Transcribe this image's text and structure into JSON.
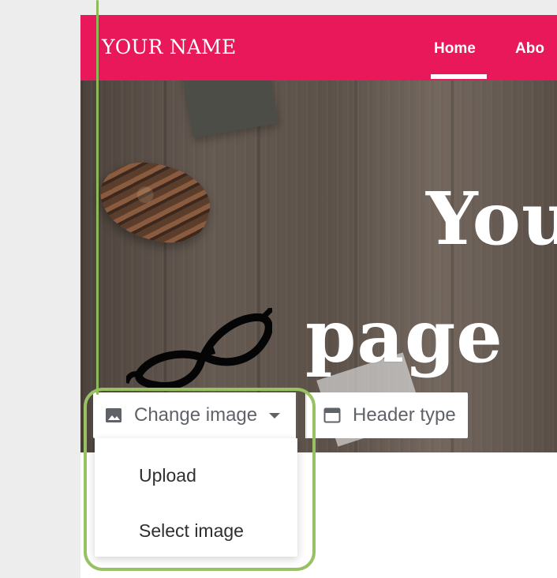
{
  "topbar": {
    "site_name": "YOUR NAME",
    "nav": {
      "home": "Home",
      "about": "Abo"
    }
  },
  "hero": {
    "title_line1": "You",
    "title_line2": "page"
  },
  "toolbar": {
    "change_image_label": "Change image",
    "header_type_label": "Header type",
    "change_image_icon": "image-icon",
    "dropdown_icon": "chevron-down-icon",
    "header_type_icon": "header-layout-icon"
  },
  "dropdown": {
    "items": [
      "Upload",
      "Select image"
    ]
  },
  "colors": {
    "brand_accent": "#e8185a",
    "callout_green": "#97c162"
  }
}
